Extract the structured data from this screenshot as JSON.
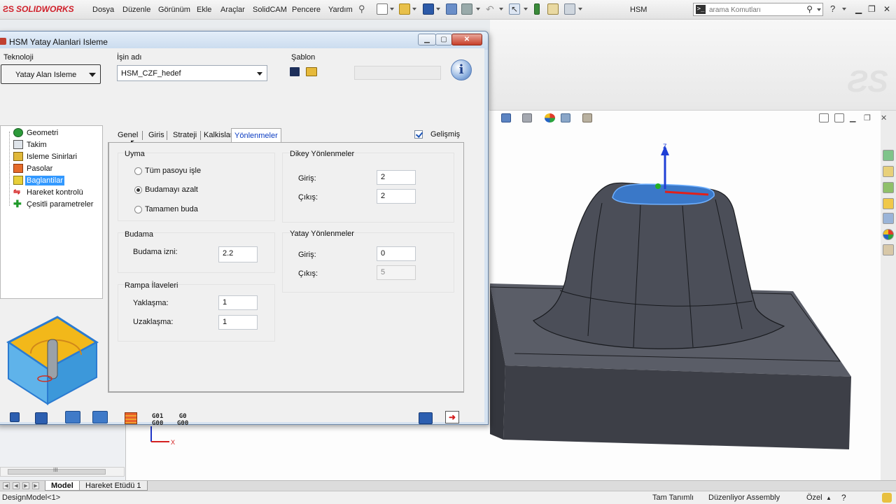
{
  "app": {
    "logo_text": "SOLIDWORKS",
    "menu": [
      "Dosya",
      "Düzenle",
      "Görünüm",
      "Ekle",
      "Araçlar",
      "SolidCAM",
      "Pencere",
      "Yardım"
    ],
    "window_title": "HSM",
    "search_placeholder": "arama Komutları",
    "help_label": "?"
  },
  "dialog": {
    "title": "HSM Yatay Alanlari Isleme",
    "close_label": "✕",
    "teknoloji_label": "Teknoloji",
    "teknoloji_value": "Yatay Alan Isleme",
    "job_name_label": "İşin adı",
    "job_name_value": "HSM_CZF_hedef",
    "sablon_label": "Şablon",
    "gelismis_label": "Gelişmiş",
    "tree": [
      {
        "label": "Geometri",
        "icon": "geometry-icon"
      },
      {
        "label": "Takim",
        "icon": "tool-icon"
      },
      {
        "label": "Isleme Sinirlari",
        "icon": "boundary-icon"
      },
      {
        "label": "Pasolar",
        "icon": "passes-icon"
      },
      {
        "label": "Baglantilar",
        "icon": "links-icon",
        "selected": true
      },
      {
        "label": "Hareket kontrolü",
        "icon": "motion-control-icon"
      },
      {
        "label": "Çesitli parametreler",
        "icon": "misc-params-icon"
      }
    ],
    "tabs": [
      "Genel",
      "Giris",
      "Strateji",
      "Kalkislar",
      "Yönlenmeler"
    ],
    "active_tab": "Yönlenmeler",
    "uyma": {
      "title": "Uyma",
      "options": [
        "Tüm pasoyu işle",
        "Budamayı azalt",
        "Tamamen buda"
      ],
      "selected_index": 1
    },
    "budama": {
      "title": "Budama",
      "izni_label": "Budama izni:",
      "izni_value": "2.2"
    },
    "rampa": {
      "title": "Rampa İlaveleri",
      "yaklasma_label": "Yaklaşma:",
      "yaklasma_value": "1",
      "uzaklasma_label": "Uzaklaşma:",
      "uzaklasma_value": "1"
    },
    "dikey": {
      "title": "Dikey Yönlenmeler",
      "giris_label": "Giriş:",
      "giris_value": "2",
      "cikis_label": "Çıkış:",
      "cikis_value": "2"
    },
    "yatay": {
      "title": "Yatay Yönlenmeler",
      "giris_label": "Giriş:",
      "giris_value": "0",
      "cikis_label": "Çıkış:",
      "cikis_value": "5"
    },
    "gcode_1": [
      "G01",
      "G00"
    ],
    "gcode_2": [
      "G0",
      "G00"
    ]
  },
  "bottom_tabs": [
    "Model",
    "Hareket Etüdü 1"
  ],
  "scroll_glyph": "III",
  "triad_labels": {
    "x": "X",
    "z": "Z"
  },
  "status": {
    "left": "DesignModel<1>",
    "defined": "Tam Tanımlı",
    "editing": "Düzenliyor Assembly",
    "custom": "Özel"
  },
  "colors": {
    "selection_blue": "#3399ff",
    "active_tab_text": "#0b3cc2",
    "model_gray": "#4b4e58",
    "solidworks_red": "#d0202a"
  }
}
